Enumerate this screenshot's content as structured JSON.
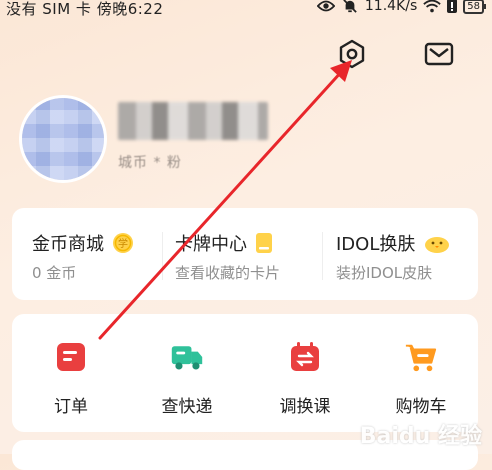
{
  "status_bar": {
    "left_text": "没有 SIM 卡 傍晚6:22",
    "speed": "11.4K/s",
    "battery": "58",
    "icons": [
      "eye-icon",
      "mute-bell-icon",
      "wifi-icon",
      "alert-icon",
      "battery-icon"
    ]
  },
  "header": {
    "icons": [
      "settings-hexagon-icon",
      "mail-icon"
    ]
  },
  "profile": {
    "sub_info": "城币 * 粉"
  },
  "features": [
    {
      "title": "金币商城",
      "sub": "0 金币",
      "badge_icon": "coin-icon",
      "badge_text": "学"
    },
    {
      "title": "卡牌中心",
      "sub": "查看收藏的卡片",
      "badge_icon": "card-icon"
    },
    {
      "title": "IDOL换肤",
      "sub": "装扮IDOL皮肤",
      "badge_icon": "chick-icon"
    }
  ],
  "shortcuts": [
    {
      "label": "订单",
      "icon": "order-icon",
      "color": "#e93f3f"
    },
    {
      "label": "查快递",
      "icon": "delivery-truck-icon",
      "color": "#2fc19a"
    },
    {
      "label": "调换课",
      "icon": "swap-calendar-icon",
      "color": "#e93f3f"
    },
    {
      "label": "购物车",
      "icon": "shopping-cart-icon",
      "color": "#ff9a1f"
    }
  ],
  "annotation": {
    "color": "#e8262b"
  },
  "watermark": "Baidu 经验"
}
